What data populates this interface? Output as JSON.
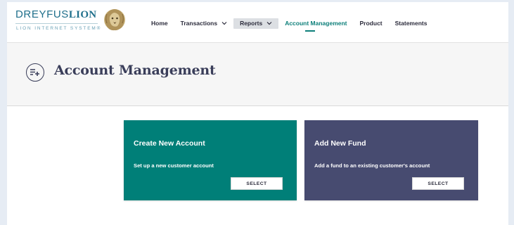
{
  "brand": {
    "name_part1": "DREYFUS",
    "name_part2": "LION",
    "tagline": "LION INTERNET SYSTEM",
    "trademark": "®",
    "logo_icon": "lion-head-icon"
  },
  "nav": {
    "items": [
      {
        "label": "Home",
        "dropdown": false,
        "active": false,
        "highlight": false
      },
      {
        "label": "Transactions",
        "dropdown": true,
        "active": false,
        "highlight": false
      },
      {
        "label": "Reports",
        "dropdown": true,
        "active": false,
        "highlight": true
      },
      {
        "label": "Account Management",
        "dropdown": false,
        "active": true,
        "highlight": false
      },
      {
        "label": "Product",
        "dropdown": false,
        "active": false,
        "highlight": false
      },
      {
        "label": "Statements",
        "dropdown": false,
        "active": false,
        "highlight": false
      }
    ]
  },
  "page": {
    "title": "Account Management",
    "title_icon": "list-add-icon"
  },
  "cards": [
    {
      "title": "Create New Account",
      "description": "Set up a new customer account",
      "button": "SELECT",
      "color": "#007f78"
    },
    {
      "title": "Add New Fund",
      "description": "Add a fund to an existing customer's account",
      "button": "SELECT",
      "color": "#474b70"
    }
  ],
  "colors": {
    "accent": "#0d7f7a",
    "title_text": "#3a3e5a",
    "outer_background": "#e6ecf4"
  }
}
